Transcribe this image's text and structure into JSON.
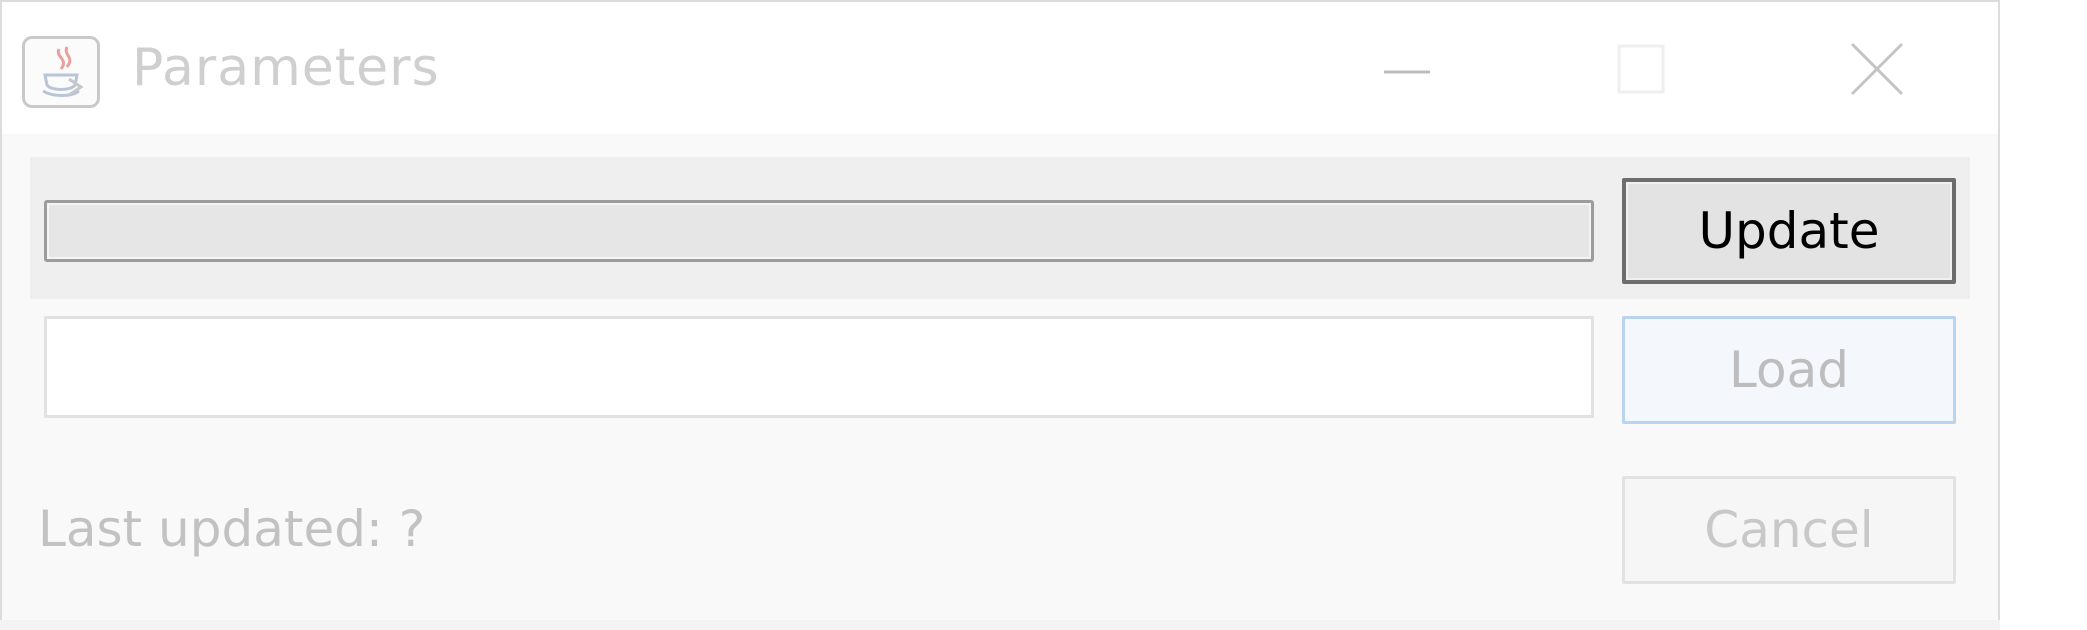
{
  "window": {
    "title": "Parameters",
    "icon": "java-app-icon",
    "controls": {
      "minimize_icon": "minimize-icon",
      "maximize_icon": "maximize-icon",
      "close_icon": "close-icon"
    }
  },
  "update_row": {
    "progress_fraction": 0,
    "update_label": "Update"
  },
  "load_row": {
    "input_value": "",
    "load_label": "Load"
  },
  "footer": {
    "status_text": "Last updated: ?",
    "cancel_label": "Cancel"
  },
  "colors": {
    "focus_border": "#b9d4ee",
    "disabled_text": "#c2c2c2"
  }
}
